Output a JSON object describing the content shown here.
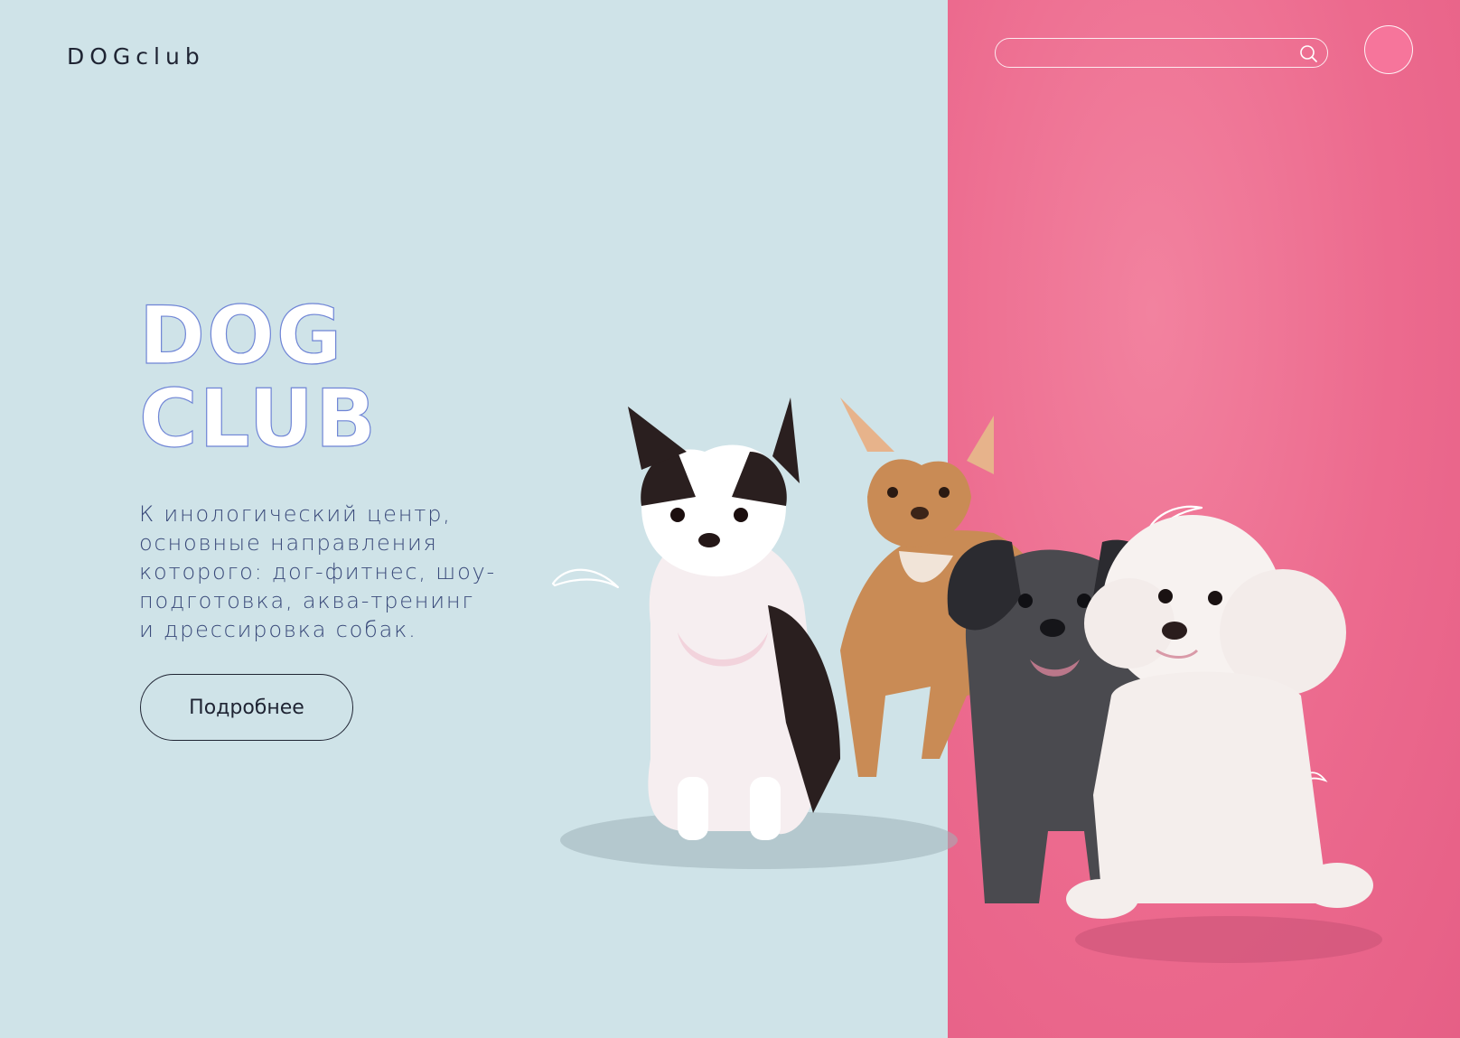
{
  "header": {
    "logo": "DOGclub",
    "search": {
      "placeholder": "",
      "value": ""
    }
  },
  "hero": {
    "title_lines": [
      "DOG",
      "CLUB"
    ],
    "description_lines": [
      "К инологический центр,",
      "основные направления",
      "которого: дог-фитнес, шоу-",
      "подготовка, аква-тренинг",
      "и дрессировка собак."
    ],
    "button_label": "Подробнее"
  },
  "colors": {
    "left_background": "#cfe3e8",
    "right_background": "#ec6a8e",
    "title_outline": "#6f85d6",
    "text": "#3a4a7a"
  },
  "icons": [
    "search-icon",
    "avatar"
  ]
}
